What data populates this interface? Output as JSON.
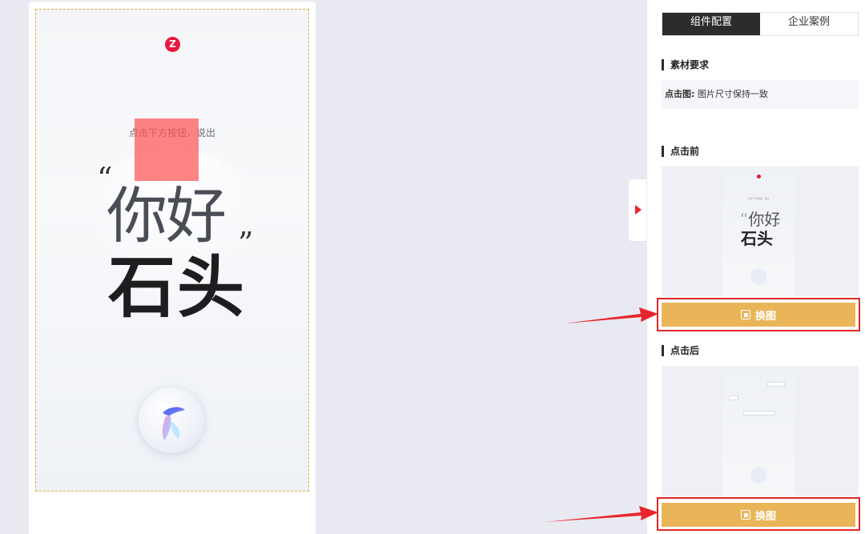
{
  "preview": {
    "logo_text": "Z",
    "hint": "点击下方按钮，说出",
    "quote_open": "“",
    "quote_close": "”",
    "line1": "你好",
    "line2": "石头"
  },
  "panel": {
    "tabs": [
      {
        "label": "组件配置",
        "active": true
      },
      {
        "label": "企业案例",
        "active": false
      }
    ],
    "material_title": "素材要求",
    "req_label": "点击图:",
    "req_value": "图片尺寸保持一致",
    "before_title": "点击前",
    "after_title": "点击后",
    "swap_label": "换图"
  },
  "thumb_before": {
    "hint": "点击下方按钮，说出",
    "line1": "“你好",
    "line2": "石头",
    "quote_close": "”"
  },
  "colors": {
    "accent_red": "#e8252c",
    "button_gold": "#eab559",
    "tab_active": "#2c2c2e"
  }
}
